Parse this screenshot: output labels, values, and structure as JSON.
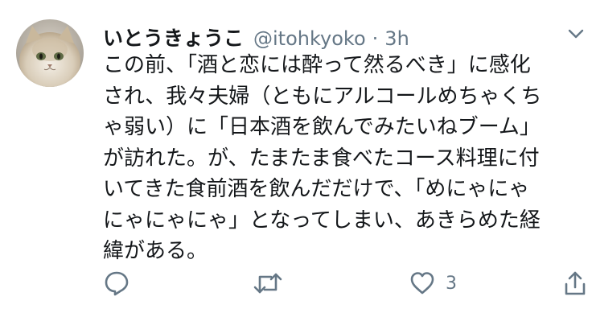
{
  "tweet": {
    "display_name": "いとうきょうこ",
    "handle": "@itohkyoko",
    "separator": "·",
    "time": "3h",
    "body_lines": [
      "この前、「酒と恋には酔って然るべき」に感化",
      "され、我々夫婦（ともにアルコールめちゃくち",
      "ゃ弱い）に「日本酒を飲んでみたいねブーム」",
      "が訪れた。が、たまたま食べたコース料理に付",
      "いてきた食前酒を飲んだだけで、「めにゃにゃ",
      "にゃにゃにゃ」となってしまい、あきらめた経",
      "緯がある。"
    ],
    "like_count": "3"
  },
  "icons": {
    "reply": "reply-icon",
    "retweet": "retweet-icon",
    "like": "like-icon",
    "share": "share-icon",
    "more": "chevron-down-icon"
  },
  "colors": {
    "text_primary": "#14171a",
    "text_secondary": "#657786",
    "background": "#ffffff"
  }
}
